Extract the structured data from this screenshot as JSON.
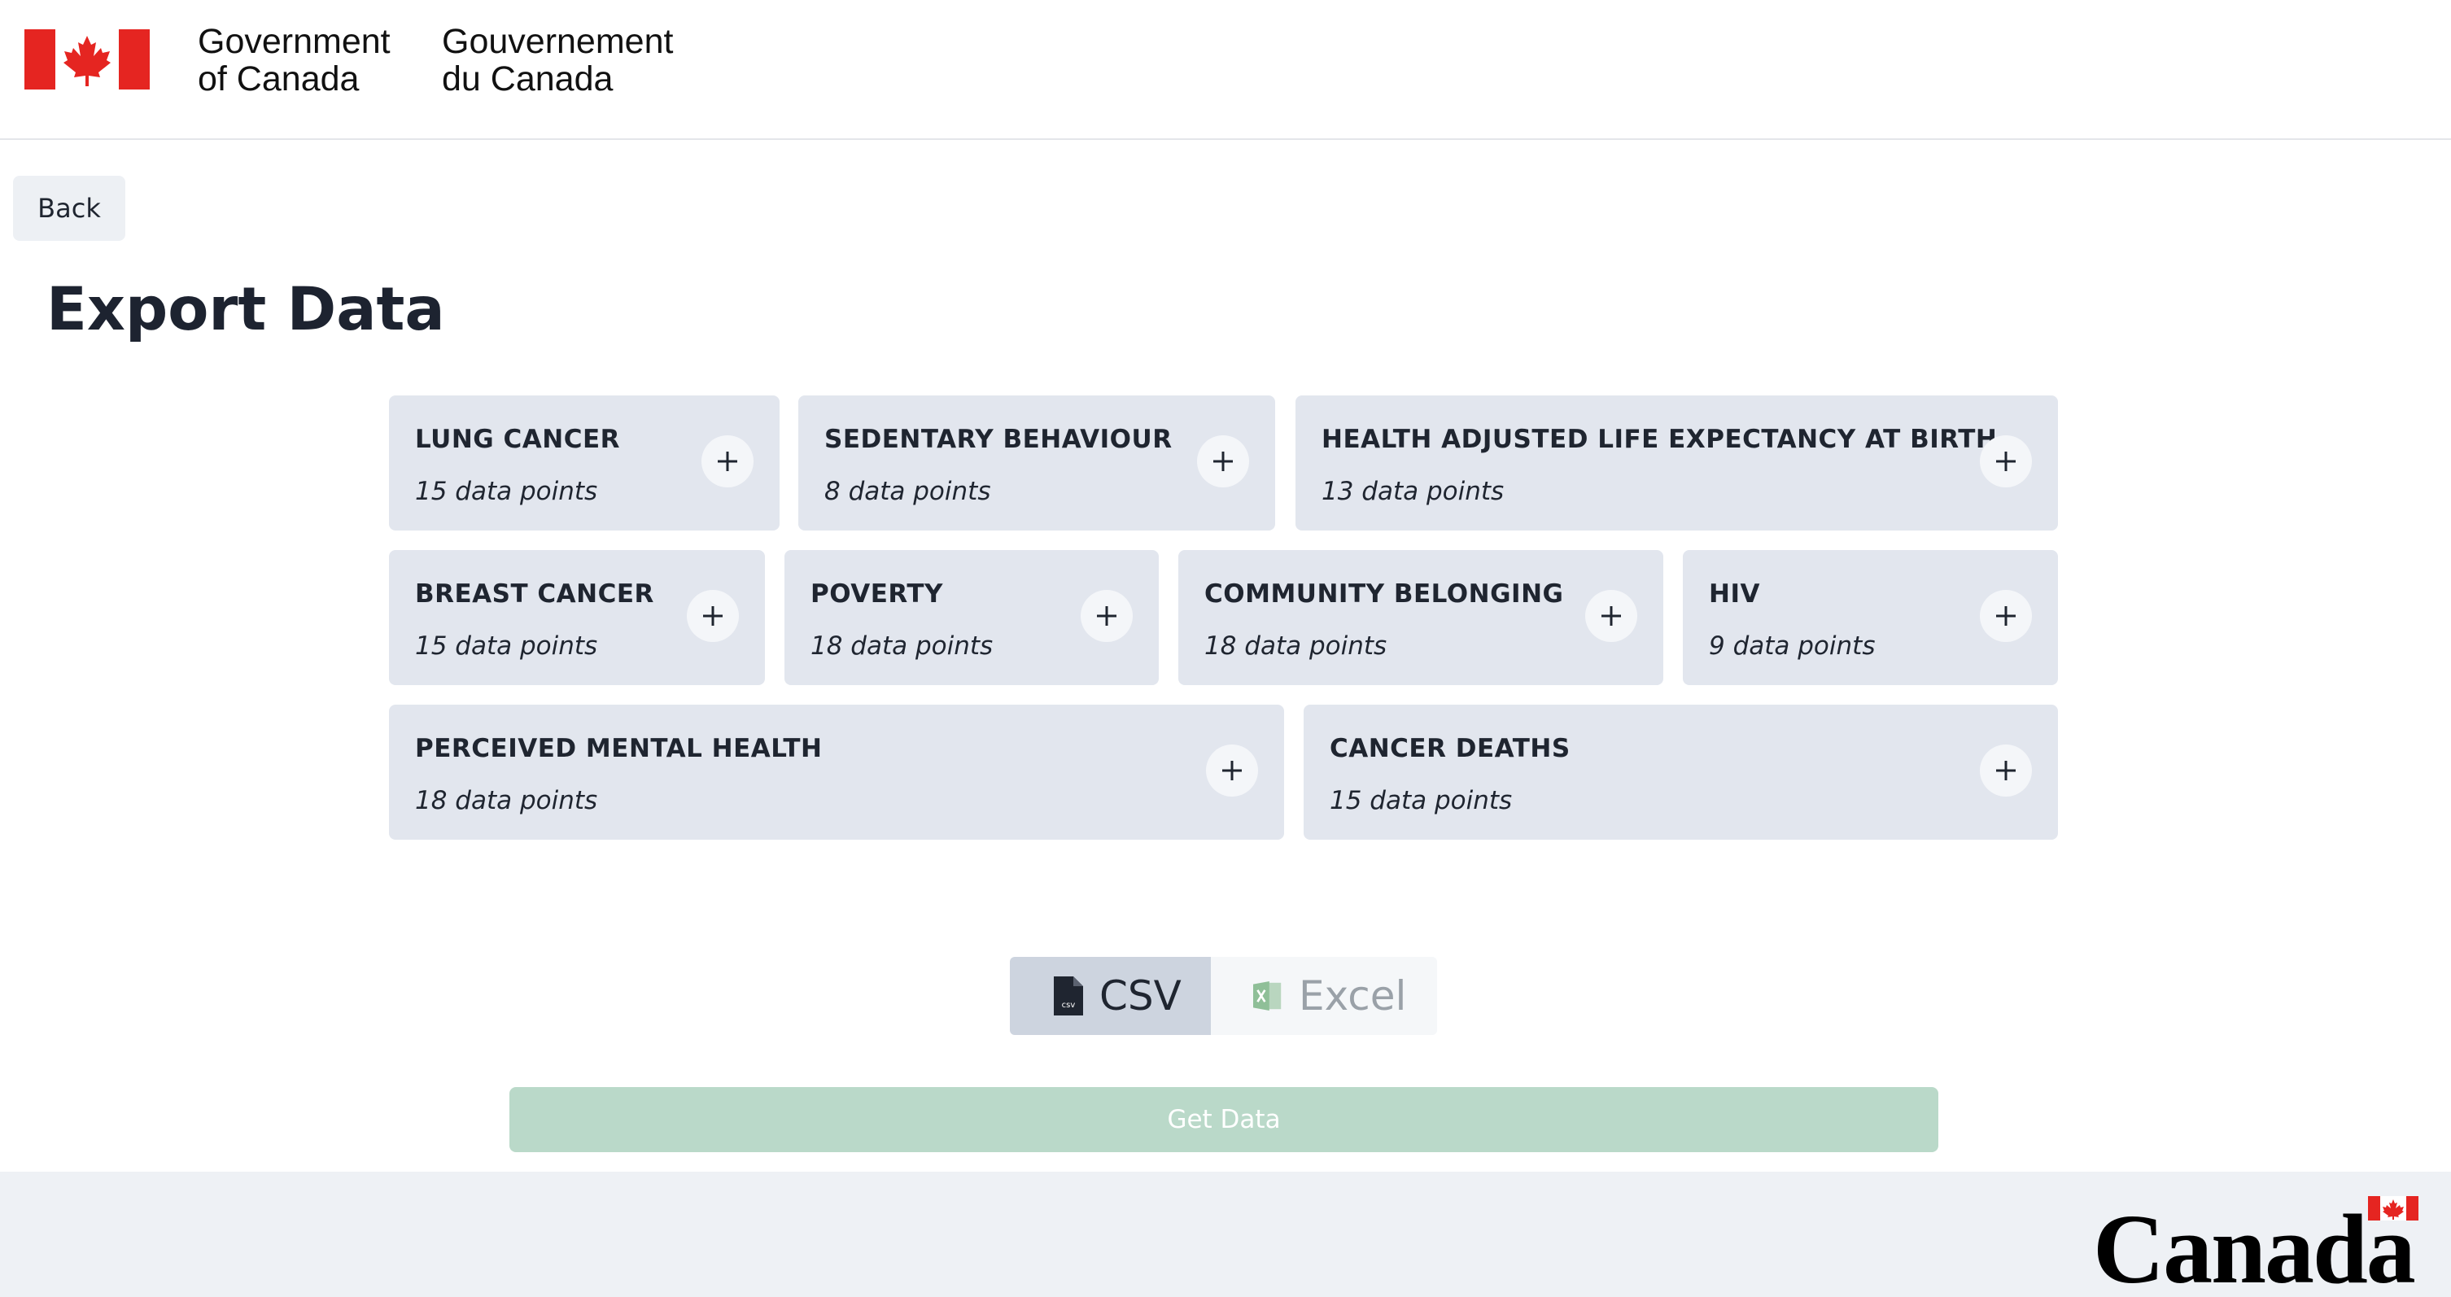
{
  "header": {
    "title_en_line1": "Government",
    "title_en_line2": "of Canada",
    "title_fr_line1": "Gouvernement",
    "title_fr_line2": "du Canada"
  },
  "back_label": "Back",
  "page_title": "Export Data",
  "datasets": [
    {
      "name": "LUNG CANCER",
      "count": "15 data points"
    },
    {
      "name": "SEDENTARY BEHAVIOUR",
      "count": "8 data points"
    },
    {
      "name": "HEALTH ADJUSTED LIFE EXPECTANCY AT BIRTH",
      "count": "13 data points"
    },
    {
      "name": "BREAST CANCER",
      "count": "15 data points"
    },
    {
      "name": "POVERTY",
      "count": "18 data points"
    },
    {
      "name": "COMMUNITY BELONGING",
      "count": "18 data points"
    },
    {
      "name": "HIV",
      "count": "9 data points"
    },
    {
      "name": "PERCEIVED MENTAL HEALTH",
      "count": "18 data points"
    },
    {
      "name": "CANCER DEATHS",
      "count": "15 data points"
    }
  ],
  "format_options": [
    {
      "label": "CSV",
      "icon": "csv-file-icon",
      "selected": true
    },
    {
      "label": "Excel",
      "icon": "excel-file-icon",
      "selected": false
    }
  ],
  "get_data_label": "Get Data",
  "footer_wordmark": "Canada",
  "colors": {
    "flag_red": "#e52521",
    "card_bg": "#e2e6ee",
    "get_data_bg": "#bad9c9",
    "csv_selected_bg": "#cdd4df"
  }
}
